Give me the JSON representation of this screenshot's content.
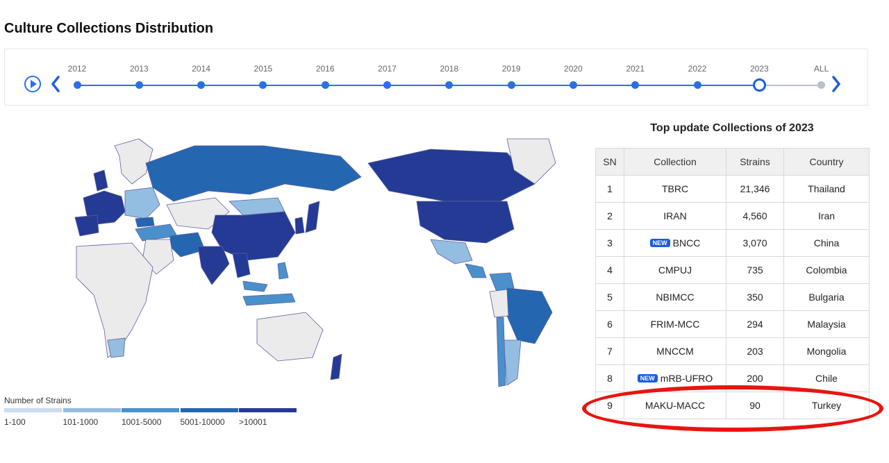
{
  "page": {
    "title": "Culture Collections Distribution"
  },
  "timeline": {
    "years": [
      "2012",
      "2013",
      "2014",
      "2015",
      "2016",
      "2017",
      "2018",
      "2019",
      "2020",
      "2021",
      "2022",
      "2023",
      "ALL"
    ],
    "selected": "2023"
  },
  "legend": {
    "title": "Number of Strains",
    "bins": [
      {
        "label": "1-100",
        "color": "#c9dcf0"
      },
      {
        "label": "101-1000",
        "color": "#94bde2"
      },
      {
        "label": "1001-5000",
        "color": "#4a90cb"
      },
      {
        "label": "5001-10000",
        "color": "#2566b0"
      },
      {
        "label": ">10001",
        "color": "#243a94"
      }
    ]
  },
  "table": {
    "title": "Top update Collections of 2023",
    "columns": [
      "SN",
      "Collection",
      "Strains",
      "Country"
    ],
    "new_badge": "NEW",
    "rows": [
      {
        "sn": "1",
        "collection": "TBRC",
        "strains": "21,346",
        "country": "Thailand"
      },
      {
        "sn": "2",
        "collection": "IRAN",
        "strains": "4,560",
        "country": "Iran"
      },
      {
        "sn": "3",
        "collection": "BNCC",
        "strains": "3,070",
        "country": "China",
        "new": true
      },
      {
        "sn": "4",
        "collection": "CMPUJ",
        "strains": "735",
        "country": "Colombia"
      },
      {
        "sn": "5",
        "collection": "NBIMCC",
        "strains": "350",
        "country": "Bulgaria"
      },
      {
        "sn": "6",
        "collection": "FRIM-MCC",
        "strains": "294",
        "country": "Malaysia"
      },
      {
        "sn": "7",
        "collection": "MNCCM",
        "strains": "203",
        "country": "Mongolia"
      },
      {
        "sn": "8",
        "collection": "mRB-UFRO",
        "strains": "200",
        "country": "Chile",
        "new": true
      },
      {
        "sn": "9",
        "collection": "MAKU-MACC",
        "strains": "90",
        "country": "Turkey"
      }
    ],
    "highlighted_row": "9"
  },
  "colors": {
    "accent": "#2a6ef0",
    "highlight": "#e8150f",
    "land_default": "#ebebeb",
    "border": "#5a5fa0"
  }
}
